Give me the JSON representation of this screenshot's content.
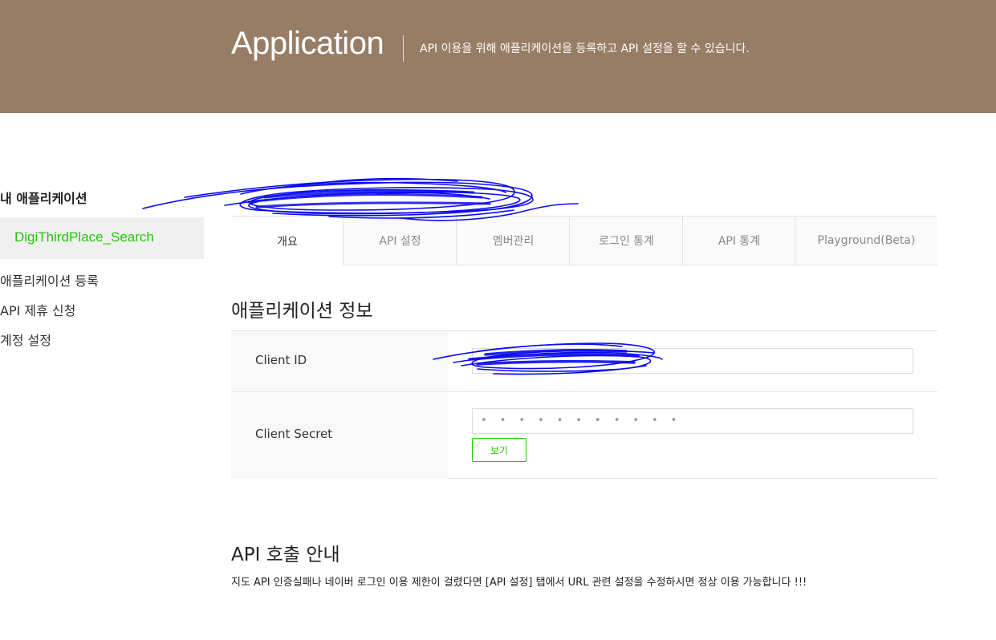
{
  "banner": {
    "title": "Application",
    "description": "API 이용을 위해 애플리케이션을 등록하고 API 설정을 할 수 있습니다."
  },
  "sidebar": {
    "title": "내 애플리케이션",
    "selected_app": "DigiThirdPlace_Search",
    "links": [
      "애플리케이션 등록",
      "API 제휴 신청",
      "계정 설정"
    ]
  },
  "tabs": [
    {
      "label": "개요",
      "active": true
    },
    {
      "label": "API 설정",
      "active": false
    },
    {
      "label": "멤버관리",
      "active": false
    },
    {
      "label": "로그인 통계",
      "active": false
    },
    {
      "label": "API 통계",
      "active": false
    },
    {
      "label": "Playground(Beta)",
      "active": false
    }
  ],
  "app_info": {
    "title": "애플리케이션 정보",
    "client_id_label": "Client ID",
    "client_id_value": "",
    "client_secret_label": "Client Secret",
    "client_secret_value": "• • • • • • • • • • •",
    "show_button": "보기"
  },
  "api_guide": {
    "title": "API 호출 안내",
    "text": "지도 API 인증실패나 네이버 로그인 이용 제한이 걸렸다면 [API 설정] 탭에서 URL 관련 설정을 수정하시면 정상 이용 가능합니다 !!!"
  },
  "colors": {
    "banner": "#977d65",
    "accent_green": "#1ec800",
    "redaction_blue": "#0a0af0"
  }
}
